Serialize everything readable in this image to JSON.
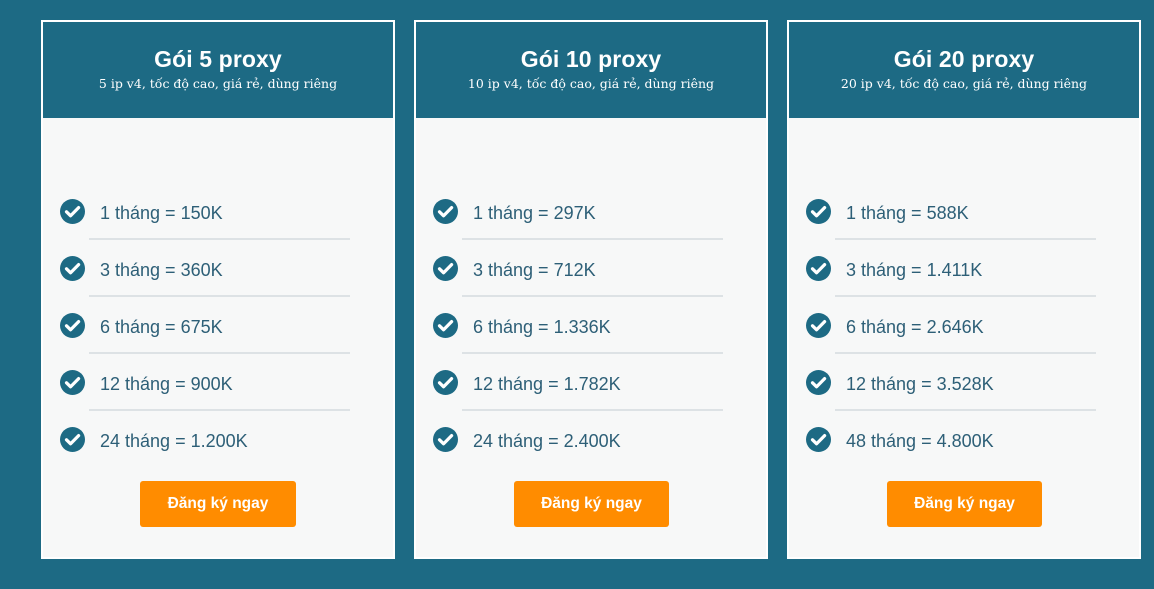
{
  "colors": {
    "background": "#1d6a84",
    "card_background": "#f7f8f8",
    "card_header": "#1d6a84",
    "button": "#ff8c00",
    "price_text": "#2d5f77",
    "check_icon": "#1d6a84"
  },
  "plans": [
    {
      "title": "Gói 5 proxy",
      "subtitle": "5 ip v4, tốc độ cao, giá rẻ, dùng riêng",
      "prices": [
        "1 tháng = 150K",
        "3 tháng = 360K",
        "6 tháng = 675K",
        "12 tháng = 900K",
        "24 tháng = 1.200K"
      ],
      "button_label": "Đăng ký ngay"
    },
    {
      "title": "Gói 10 proxy",
      "subtitle": "10 ip v4, tốc độ cao, giá rẻ, dùng riêng",
      "prices": [
        "1 tháng = 297K",
        "3 tháng = 712K",
        "6 tháng = 1.336K",
        "12 tháng = 1.782K",
        "24 tháng = 2.400K"
      ],
      "button_label": "Đăng ký ngay"
    },
    {
      "title": "Gói 20 proxy",
      "subtitle": "20 ip v4, tốc độ cao, giá rẻ, dùng riêng",
      "prices": [
        "1 tháng = 588K",
        "3 tháng = 1.411K",
        "6 tháng = 2.646K",
        "12 tháng = 3.528K",
        "48 tháng = 4.800K"
      ],
      "button_label": "Đăng ký ngay"
    }
  ],
  "icons": {
    "list_bullet": "check-circle-icon"
  }
}
